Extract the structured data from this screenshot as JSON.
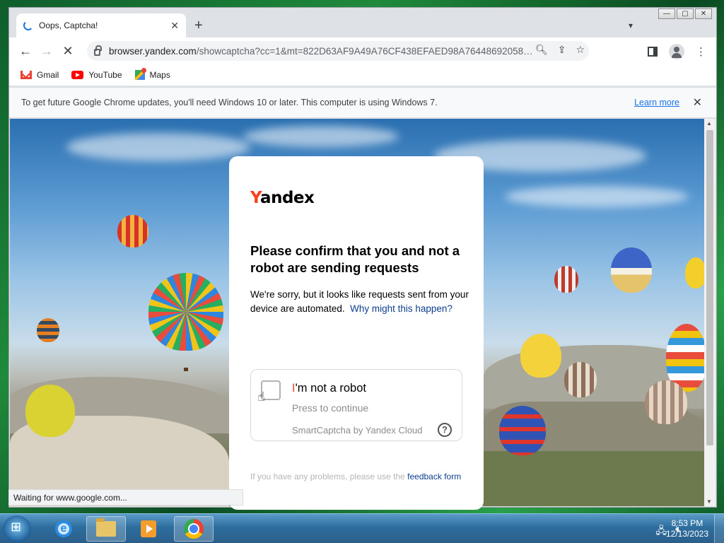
{
  "browser": {
    "tab": {
      "title": "Oops, Captcha!"
    },
    "address": {
      "host": "browser.yandex.com",
      "path": "/showcaptcha?cc=1&mt=822D63AF9A49A76CF438EFAED98A764486920586116FB..."
    },
    "bookmarks": [
      {
        "label": "Gmail",
        "icon": "gmail-icon"
      },
      {
        "label": "YouTube",
        "icon": "youtube-icon"
      },
      {
        "label": "Maps",
        "icon": "maps-icon"
      }
    ],
    "infobar": {
      "message": "To get future Google Chrome updates, you'll need Windows 10 or later. This computer is using Windows 7.",
      "link": "Learn more"
    },
    "status": "Waiting for www.google.com..."
  },
  "captcha_page": {
    "logo_first": "Y",
    "logo_rest": "andex",
    "heading": "Please confirm that you and not a robot are sending requests",
    "description": "We're sorry, but it looks like requests sent from your device are automated.",
    "why_link": "Why might this happen?",
    "widget": {
      "label_first": "I",
      "label_rest": "'m not a robot",
      "hint": "Press to continue",
      "brand": "SmartCaptcha by Yandex Cloud",
      "help": "?"
    },
    "footer_text": "If you have any problems, please use the",
    "footer_link": "feedback form"
  },
  "taskbar": {
    "apps": [
      "internet-explorer-icon",
      "file-explorer-icon",
      "media-player-icon",
      "chrome-icon"
    ],
    "time": "8:53 PM",
    "date": "12/13/2023"
  },
  "colors": {
    "yandex_red": "#fc3f1d",
    "link_blue": "#0e3f8f",
    "chrome_link": "#1a73e8"
  }
}
